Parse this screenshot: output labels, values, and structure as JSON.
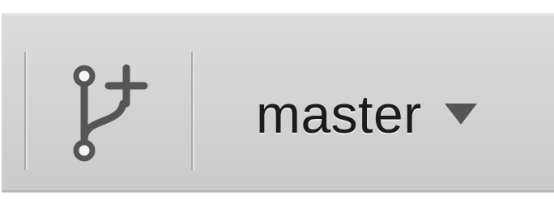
{
  "toolbar": {
    "new_branch_icon": "git-branch-add-icon",
    "current_branch": "master",
    "branch_dropdown_icon": "triangle-down-icon"
  },
  "colors": {
    "toolbar_top": "#dcdcdc",
    "toolbar_bottom": "#cbcbcb",
    "icon": "#555555",
    "text": "#1b1b1b"
  }
}
